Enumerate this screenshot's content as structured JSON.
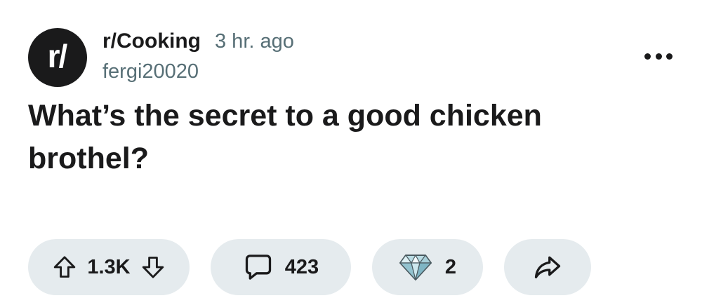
{
  "post": {
    "subreddit_icon_text": "r/",
    "subreddit": "r/Cooking",
    "time": "3 hr. ago",
    "author": "fergi20020",
    "title": "What’s the secret to a good chicken brothel?"
  },
  "actions": {
    "vote_count": "1.3K",
    "comment_count": "423",
    "award_count": "2"
  },
  "icons": {
    "overflow": "more-horizontal-icon",
    "upvote": "arrow-up-outline-icon",
    "downvote": "arrow-down-outline-icon",
    "comment": "speech-bubble-icon",
    "award": "diamond-gem-icon",
    "share": "share-arrow-icon"
  },
  "colors": {
    "text": "#1a1a1b",
    "meta": "#576f76",
    "pill_bg": "#e5ebee"
  }
}
